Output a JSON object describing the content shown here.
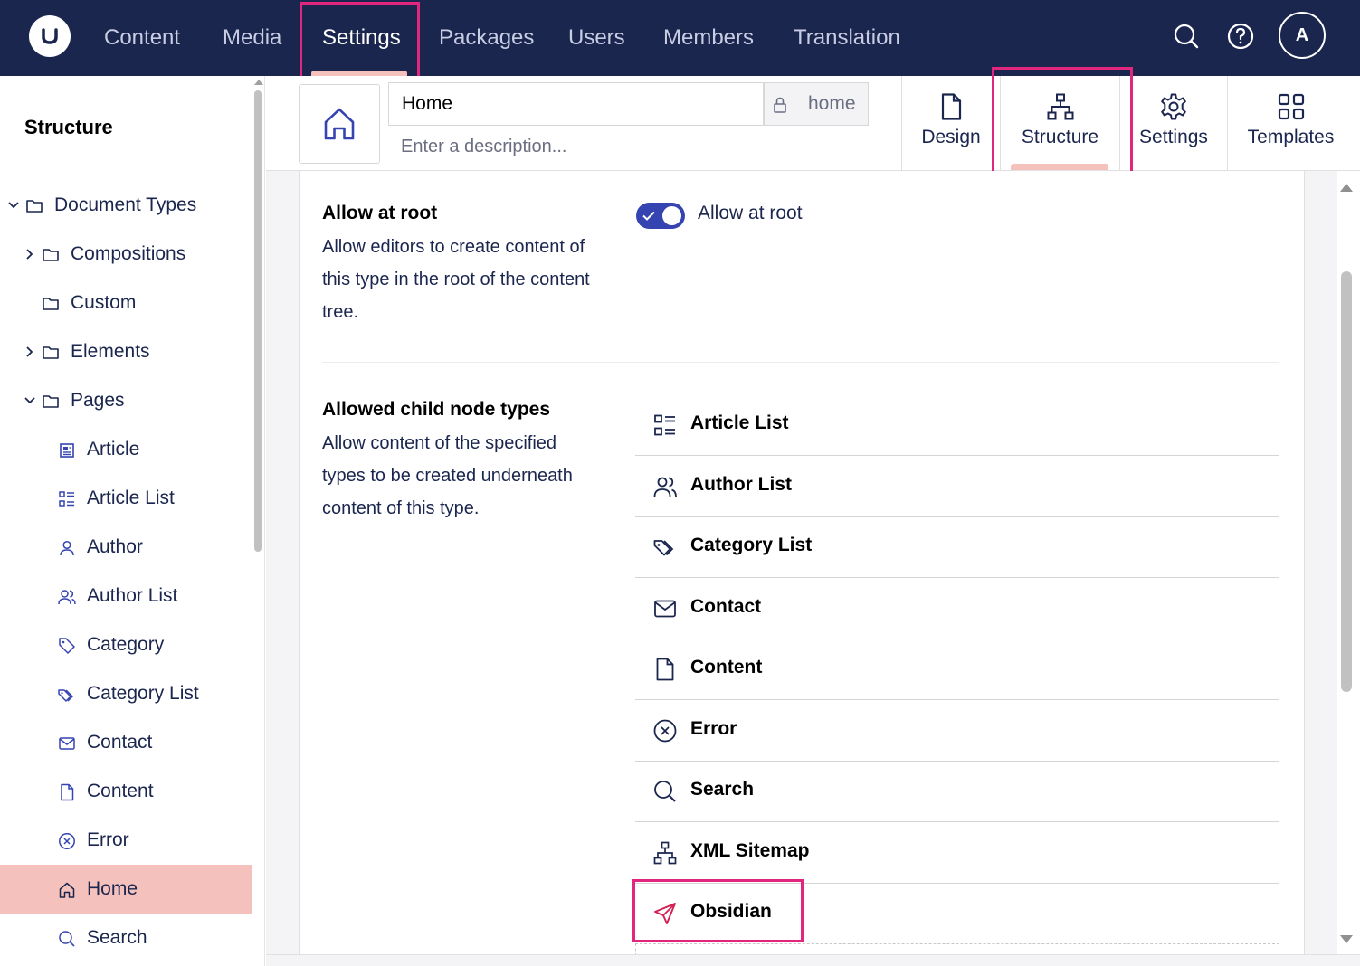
{
  "topnav": {
    "items": [
      "Content",
      "Media",
      "Settings",
      "Packages",
      "Users",
      "Members",
      "Translation"
    ],
    "active": "Settings",
    "avatar_initial": "A"
  },
  "sidebar": {
    "title": "Structure",
    "tree": [
      {
        "label": "Document Types",
        "icon": "folder-icon",
        "expanded": true
      },
      {
        "label": "Compositions",
        "icon": "folder-icon",
        "expanded": false
      },
      {
        "label": "Custom",
        "icon": "folder-icon"
      },
      {
        "label": "Elements",
        "icon": "folder-icon",
        "expanded": false
      },
      {
        "label": "Pages",
        "icon": "folder-icon",
        "expanded": true
      },
      {
        "label": "Article",
        "icon": "newspaper-icon"
      },
      {
        "label": "Article List",
        "icon": "list-icon"
      },
      {
        "label": "Author",
        "icon": "user-icon"
      },
      {
        "label": "Author List",
        "icon": "users-icon"
      },
      {
        "label": "Category",
        "icon": "tag-icon"
      },
      {
        "label": "Category List",
        "icon": "tags-icon"
      },
      {
        "label": "Contact",
        "icon": "mail-icon"
      },
      {
        "label": "Content",
        "icon": "document-icon"
      },
      {
        "label": "Error",
        "icon": "error-icon"
      },
      {
        "label": "Home",
        "icon": "home-icon",
        "selected": true
      },
      {
        "label": "Search",
        "icon": "search-icon"
      }
    ]
  },
  "doctype": {
    "name": "Home",
    "alias": "home",
    "description_placeholder": "Enter a description..."
  },
  "tabs": [
    {
      "label": "Design",
      "icon": "document-icon"
    },
    {
      "label": "Structure",
      "icon": "sitemap-icon",
      "active": true
    },
    {
      "label": "Settings",
      "icon": "gear-icon"
    },
    {
      "label": "Templates",
      "icon": "layout-icon"
    }
  ],
  "allow_root": {
    "title": "Allow at root",
    "description": "Allow editors to create content of this type in the root of the content tree.",
    "toggle_label": "Allow at root",
    "enabled": true
  },
  "child_types": {
    "title": "Allowed child node types",
    "description": "Allow content of the specified types to be created underneath content of this type.",
    "items": [
      {
        "label": "Article List",
        "icon": "list-icon"
      },
      {
        "label": "Author List",
        "icon": "users-icon"
      },
      {
        "label": "Category List",
        "icon": "tags-icon"
      },
      {
        "label": "Contact",
        "icon": "mail-icon"
      },
      {
        "label": "Content",
        "icon": "document-icon"
      },
      {
        "label": "Error",
        "icon": "error-icon"
      },
      {
        "label": "Search",
        "icon": "search-icon"
      },
      {
        "label": "XML Sitemap",
        "icon": "sitemap-icon"
      },
      {
        "label": "Obsidian",
        "icon": "paper-plane-icon"
      }
    ]
  },
  "colors": {
    "topbar": "#1b264f",
    "accent": "#f5c1bc",
    "toggle": "#3544b1",
    "highlight": "#e2267f",
    "obsidian_icon": "#d42054"
  }
}
